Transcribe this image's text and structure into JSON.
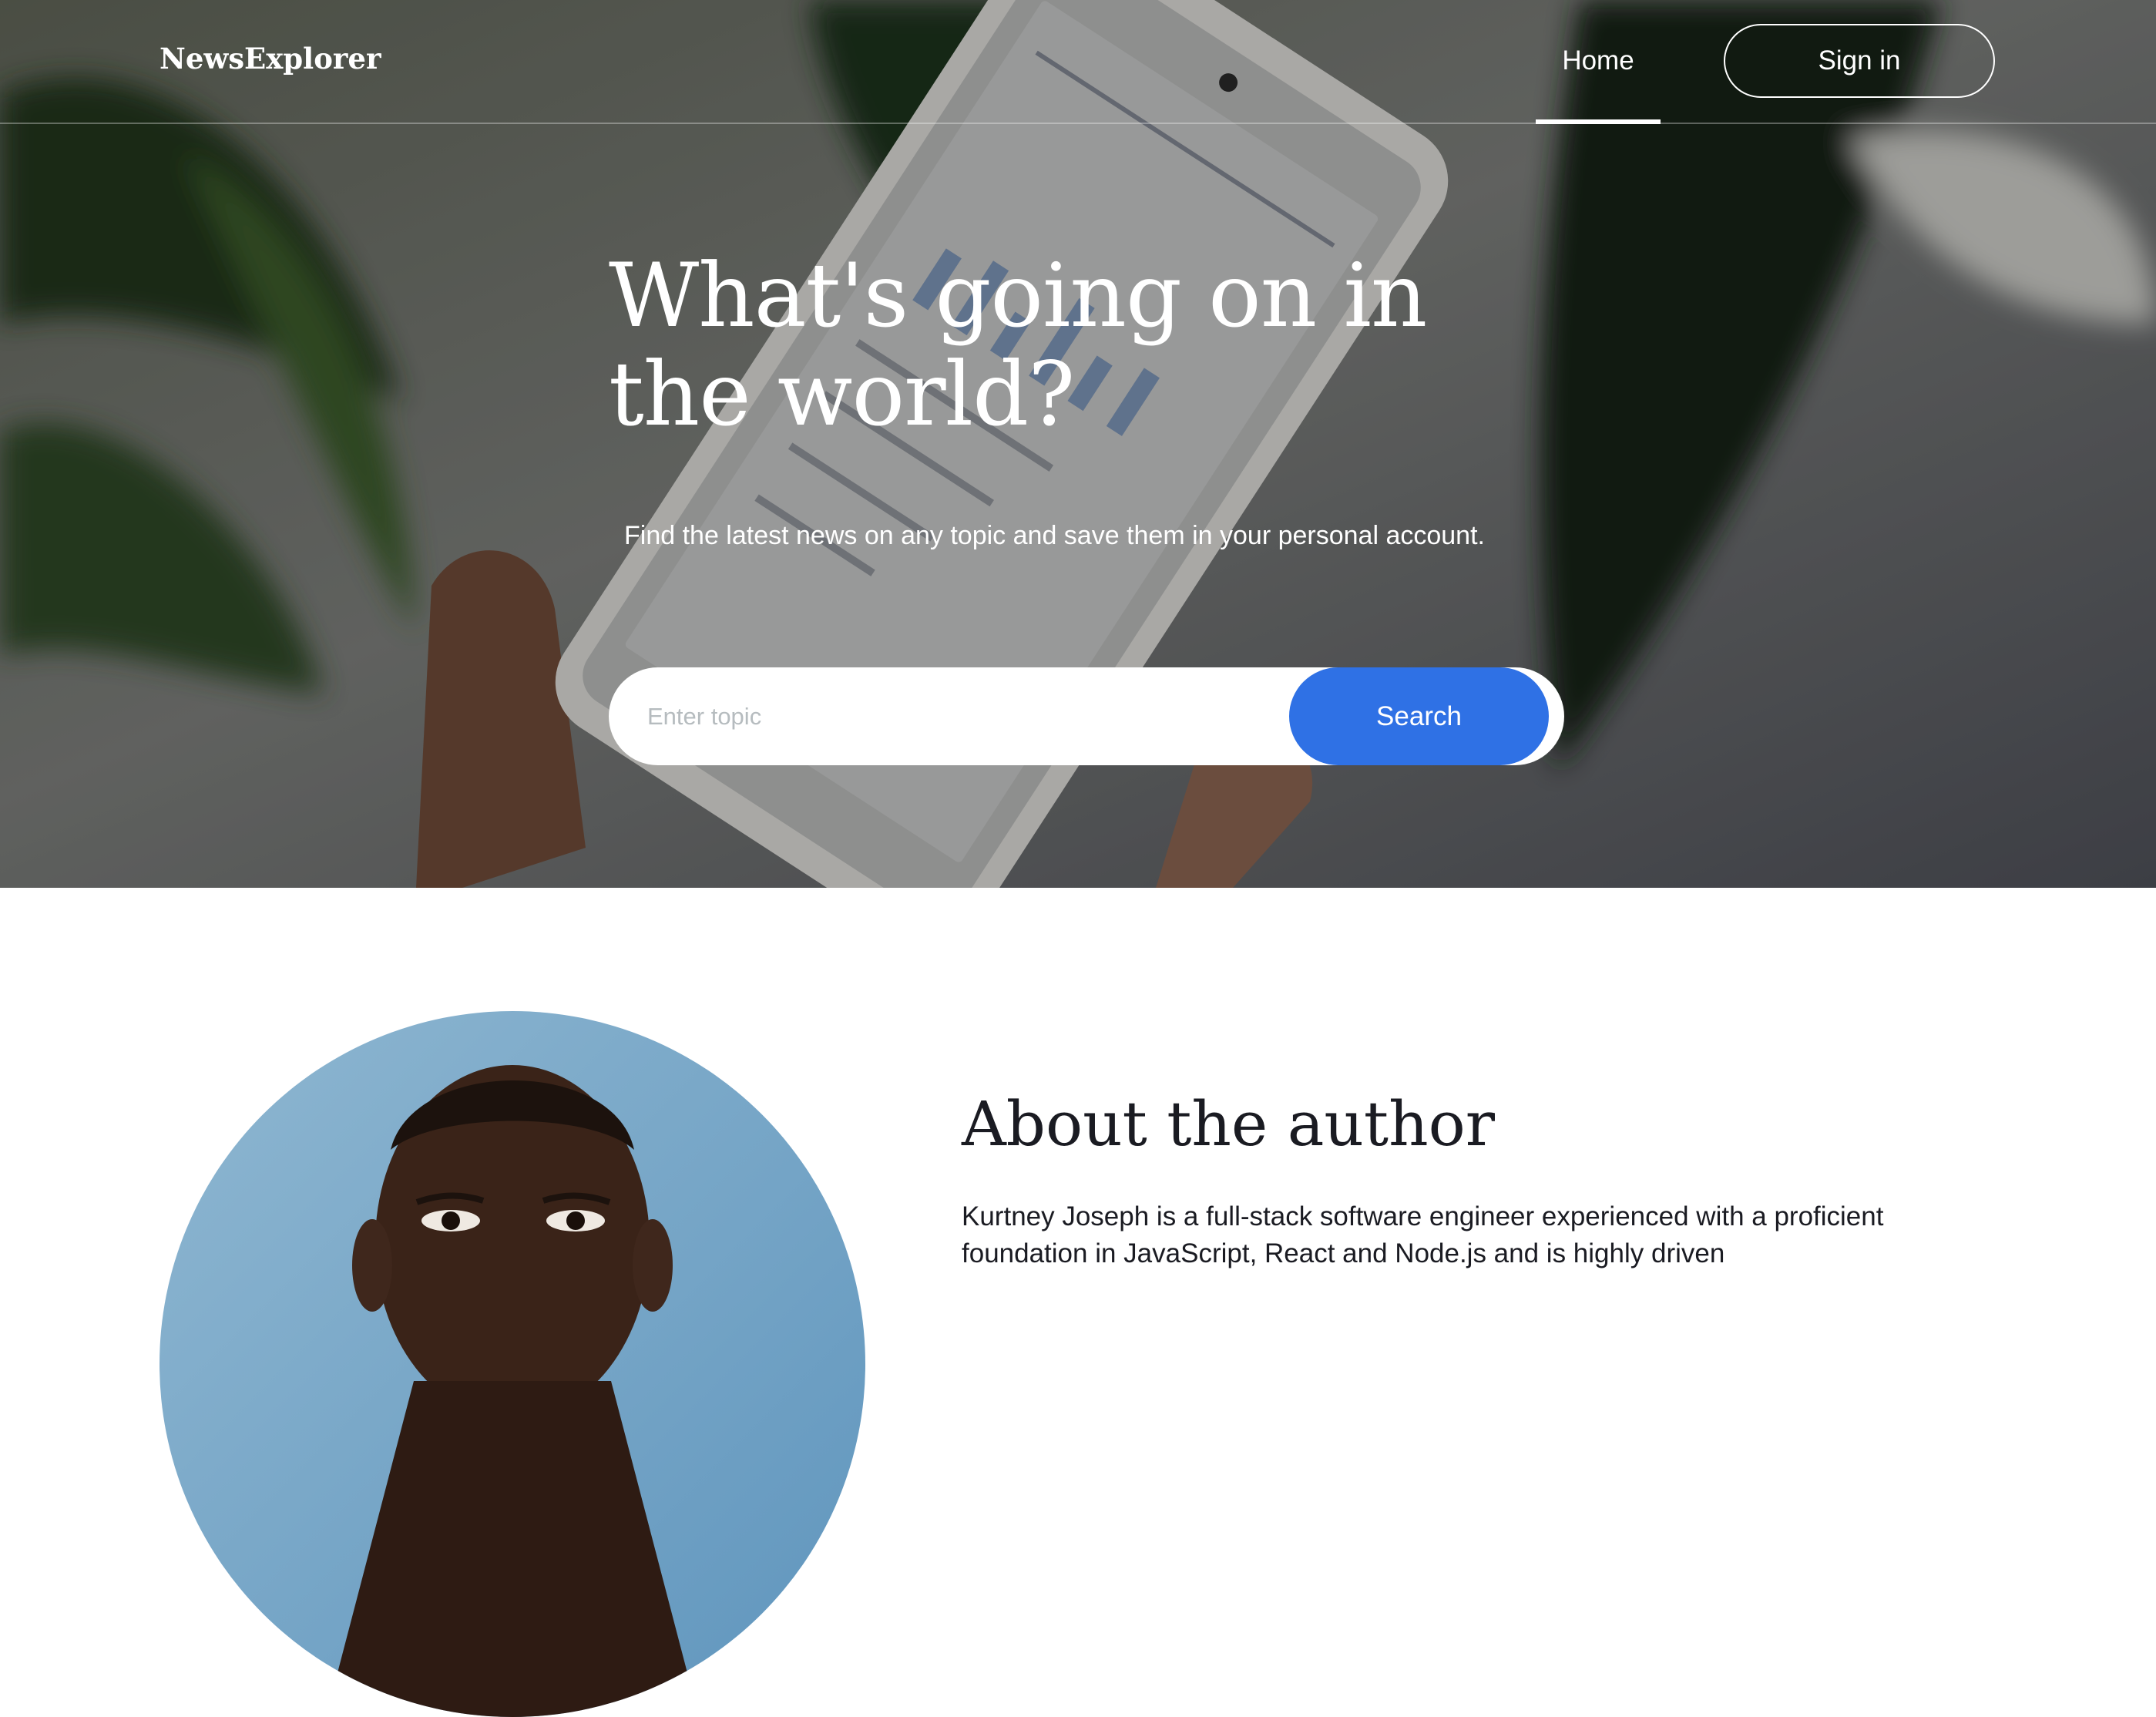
{
  "header": {
    "logo": "NewsExplorer",
    "nav": {
      "home_label": "Home",
      "signin_label": "Sign in"
    }
  },
  "hero": {
    "title": "What's going on in the world?",
    "subtitle": "Find the latest news on any topic and save them in your personal account.",
    "search": {
      "placeholder": "Enter topic",
      "button_label": "Search"
    },
    "background": "phone-insights-photo"
  },
  "about": {
    "title": "About the author",
    "text": "Kurtney Joseph is a full-stack software engineer experienced with a proficient foundation in JavaScript, React and Node.js and is highly driven",
    "photo": "author-portrait-photo"
  },
  "colors": {
    "accent": "#2f71e5",
    "text_dark": "#1a1b22",
    "placeholder": "#b6bcbf",
    "white": "#ffffff"
  }
}
